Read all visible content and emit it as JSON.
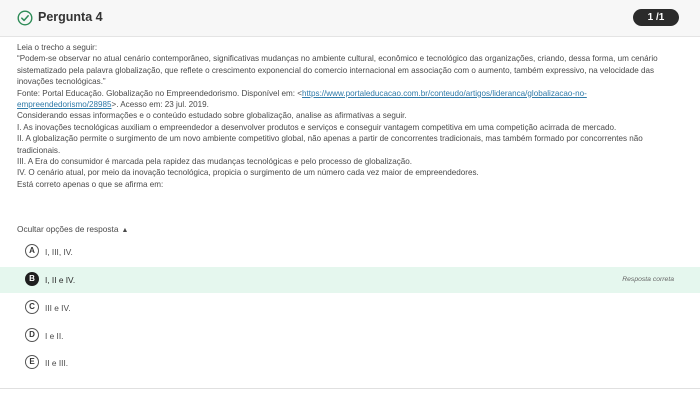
{
  "header": {
    "title": "Pergunta 4",
    "pager": "1 /1"
  },
  "question": {
    "intro": "Leia o trecho a seguir:",
    "quote": "“Podem-se observar no atual cenário contemporâneo, significativas mudanças no ambiente cultural, econômico e tecnológico das organizações, criando, dessa forma, um cenário sistematizado pela palavra globalização, que reflete o crescimento exponencial do comercio internacional em associação com o aumento, também expressivo, na velocidade das inovações tecnológicas.”",
    "source_prefix": "Fonte: Portal Educação. Globalização no Empreendedorismo. Disponível em: <",
    "source_link": "https://www.portaleducacao.com.br/conteudo/artigos/lideranca/globalizacao-no-empreendedorismo/28985",
    "source_suffix": ">. Acesso em: 23 jul. 2019.",
    "instruction": "Considerando essas informações e o conteúdo estudado sobre globalização, analise as afirmativas a seguir.",
    "statements": [
      "I. As inovações tecnológicas auxiliam o empreendedor a desenvolver produtos e serviços e conseguir vantagem competitiva em uma competição acirrada de mercado.",
      "II. A globalização permite o surgimento de um novo ambiente competitivo global, não apenas a partir de concorrentes tradicionais, mas também formado por concorrentes não tradicionais.",
      "III. A Era do consumidor é marcada pela rapidez das mudanças tecnológicas e pelo processo de globalização.",
      "IV. O cenário atual, por meio da inovação tecnológica, propicia o surgimento de um número cada vez maior de empreendedores."
    ],
    "prompt": "Está correto apenas o que se afirma em:"
  },
  "answers": {
    "toggle_label": "Ocultar opções de resposta",
    "correct_label": "Resposta correta",
    "options": [
      {
        "letter": "A",
        "text": "I, III, IV."
      },
      {
        "letter": "B",
        "text": "I, II e IV."
      },
      {
        "letter": "C",
        "text": "III e IV."
      },
      {
        "letter": "D",
        "text": "I e II."
      },
      {
        "letter": "E",
        "text": "II e III."
      }
    ]
  }
}
